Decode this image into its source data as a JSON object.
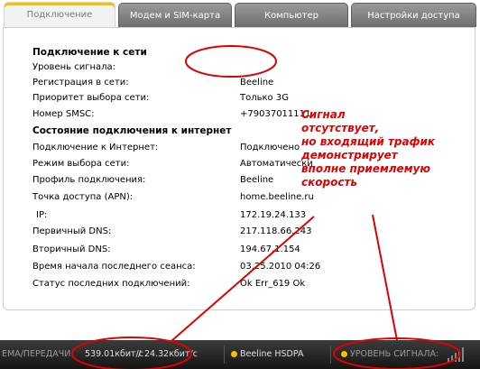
{
  "tabs": [
    "Подключение",
    "Модем и SIM-карта",
    "Компьютер",
    "Настройки доступа"
  ],
  "network": {
    "header": "Подключение к сети",
    "rows": [
      {
        "label": "Уровень сигнала:",
        "value": ""
      },
      {
        "label": "Регистрация в сети:",
        "value": "Beeline"
      },
      {
        "label": "Приоритет выбора сети:",
        "value": "Только 3G"
      },
      {
        "label": "Номер SMSC:",
        "value": "+79037011111"
      }
    ]
  },
  "internet": {
    "header": "Состояние подключения к интернет",
    "rows": [
      {
        "label": "Подключение к Интернет:",
        "value": "Подключено"
      },
      {
        "label": "Режим выбора сети:",
        "value": "Автоматически"
      },
      {
        "label": "Профиль подключения:",
        "value": "Beeline"
      },
      {
        "label": "Точка доступа (APN):",
        "value": "home.beeline.ru"
      },
      {
        "label": "IP:",
        "value": "172.19.24.133"
      },
      {
        "label": "Первичный DNS:",
        "value": "217.118.66.243"
      },
      {
        "label": "Вторичный DNS:",
        "value": "194.67.1.154"
      },
      {
        "label": "Время начала последнего сеанса:",
        "value": "03.25.2010 04:26"
      },
      {
        "label": "Статус последних подключений:",
        "value": "Ok Err_619 Ok"
      }
    ]
  },
  "statusbar": {
    "transfer_label": "ЕМА/ПЕРЕДАЧИ:",
    "receive_rate": "539.01кбит/с",
    "rate_separator": "/",
    "send_rate": "24.32кбит/с",
    "network": "Beeline HSDPA",
    "signal_label": "УРОВЕНЬ СИГНАЛА:"
  },
  "annotation": {
    "lines": [
      "Сигнал",
      "отсутствует,",
      "но входящий трафик",
      "демонстрирует",
      "вполне приемлемую",
      "скорость"
    ],
    "color": "#e00000"
  },
  "colors": {
    "accent": "#f7c000",
    "tab_dark": "#7a7a7a",
    "statusbar_bg": "#1e1e1e"
  }
}
